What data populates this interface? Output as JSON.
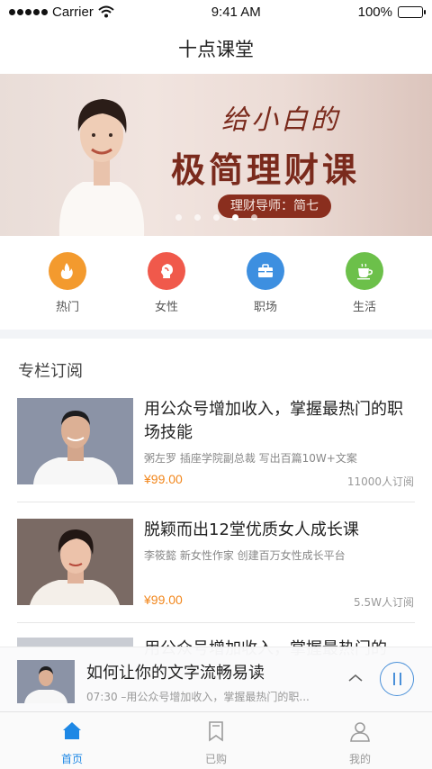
{
  "status_bar": {
    "carrier": "Carrier",
    "time": "9:41 AM",
    "battery": "100%",
    "battery_level": 1.0
  },
  "nav": {
    "title": "十点课堂"
  },
  "banner": {
    "headline_line1": "给小白的",
    "headline_line2": "极简理财课",
    "tag": "理财导师：简七",
    "slide_count": 5,
    "active_slide": 4
  },
  "categories": [
    {
      "label": "热门",
      "icon": "flame-icon",
      "color": "#f39a2e"
    },
    {
      "label": "女性",
      "icon": "female-profile-icon",
      "color": "#f0594b"
    },
    {
      "label": "职场",
      "icon": "briefcase-icon",
      "color": "#3d8fe0"
    },
    {
      "label": "生活",
      "icon": "coffee-cup-icon",
      "color": "#6cc04a"
    }
  ],
  "section": {
    "title": "专栏订阅"
  },
  "courses": [
    {
      "title": "用公众号增加收入，掌握最热门的职场技能",
      "meta": "粥左罗 插座学院副总裁 写出百篇10W+文案",
      "price": "¥99.00",
      "subscribers": "11000人订阅"
    },
    {
      "title": "脱颖而出12堂优质女人成长课",
      "meta": "李筱懿 新女性作家 创建百万女性成长平台",
      "price": "¥99.00",
      "subscribers": "5.5W人订阅"
    },
    {
      "title": "用公众号增加收入，掌握最热门的"
    }
  ],
  "player": {
    "title": "如何让你的文字流畅易读",
    "subtitle": "07:30 –用公众号增加收入，掌握最热门的职..."
  },
  "tabs": [
    {
      "label": "首页",
      "icon": "home-icon",
      "active": true
    },
    {
      "label": "已购",
      "icon": "bookmark-icon",
      "active": false
    },
    {
      "label": "我的",
      "icon": "user-icon",
      "active": false
    }
  ],
  "colors": {
    "accent": "#1e88e5",
    "price": "#f2871d",
    "banner_text": "#7a2a1c"
  }
}
